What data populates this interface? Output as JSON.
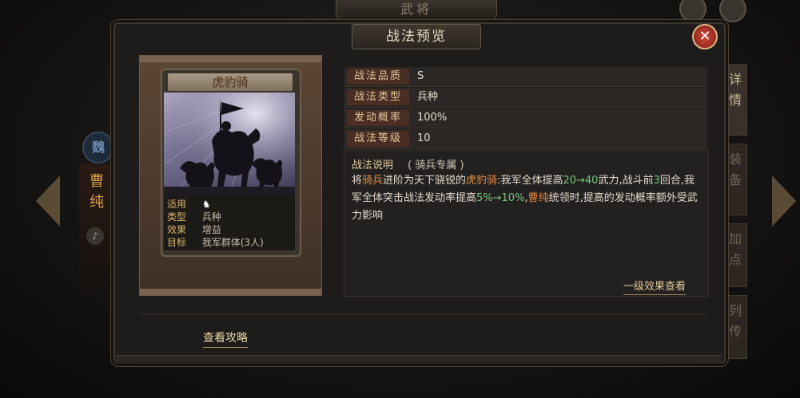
{
  "background": {
    "banner_title": "武将",
    "hero_badge": "魏",
    "hero_name": "曹纯",
    "sound_icon": "speaker-icon",
    "side_tabs": [
      "详情",
      "装备",
      "加点",
      "列传"
    ]
  },
  "dialog": {
    "title": "战法预览",
    "close_icon": "close-icon"
  },
  "card": {
    "name": "虎豹骑",
    "rows": [
      {
        "key": "适用",
        "value": "",
        "icon": "cavalry-icon"
      },
      {
        "key": "类型",
        "value": "兵种"
      },
      {
        "key": "效果",
        "value": "增益"
      },
      {
        "key": "目标",
        "value": "我军群体(3人)"
      }
    ]
  },
  "info": {
    "rows": [
      {
        "key": "战法品质",
        "value": "S"
      },
      {
        "key": "战法类型",
        "value": "兵种"
      },
      {
        "key": "发动概率",
        "value": "100%"
      },
      {
        "key": "战法等级",
        "value": "10"
      }
    ],
    "desc_label": "战法说明",
    "desc_sub": "( 骑兵专属 )",
    "desc": {
      "p1": "将",
      "p2": "骑兵",
      "p3": "进阶为天下骁锐的",
      "p4": "虎豹骑",
      "p5": ":我军全体提高",
      "p6": "20→40",
      "p7": "武力,战斗前",
      "p8": "3",
      "p9": "回合,我军全体突击战法发动率提高",
      "p10": "5%→10%",
      "p11": ",",
      "p12": "曹纯",
      "p13": "统领时,提高的发动概率额外受武力影响"
    },
    "level_link": "一级效果查看"
  },
  "footer": {
    "guide_link": "查看攻略"
  },
  "colors": {
    "accent_gold": "#e2c99a",
    "highlight_orange": "#e58a3a",
    "highlight_green": "#72c779",
    "close_red": "#d54a3a"
  }
}
